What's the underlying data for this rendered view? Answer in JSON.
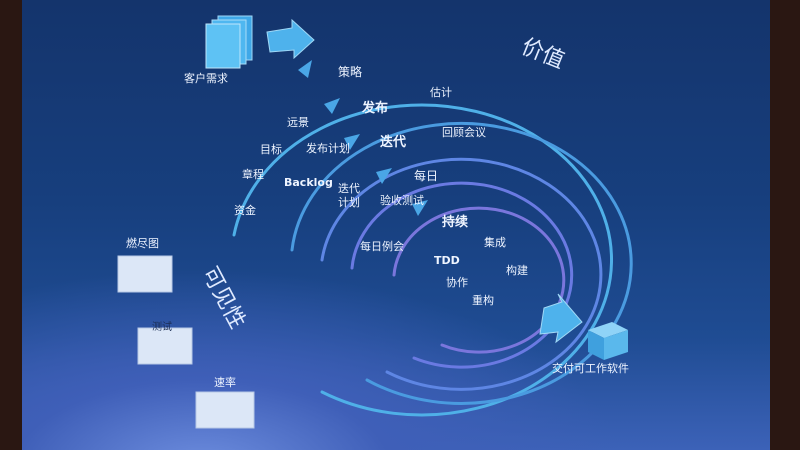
{
  "diagram": {
    "customer_requirements": "客户需求",
    "value": "价值",
    "visibility": "可见性",
    "deliver_working_software": "交付可工作软件",
    "outer_ring": {
      "strategy": "策略",
      "vision": "远景",
      "goals": "目标",
      "charter": "章程",
      "funding": "资金"
    },
    "release_ring": {
      "release": "发布",
      "estimate": "估计",
      "release_plan": "发布计划",
      "backlog": "Backlog"
    },
    "iteration_ring": {
      "iteration": "迭代",
      "retrospective": "回顾会议",
      "iteration_plan": "迭代\n计划"
    },
    "daily_ring": {
      "daily": "每日",
      "acceptance_test": "验收测试",
      "daily_standup": "每日例会"
    },
    "continuous_ring": {
      "continuous": "持续",
      "integration": "集成",
      "tdd": "TDD",
      "build": "构建",
      "collaboration": "协作",
      "refactor": "重构"
    },
    "side_boxes": {
      "burndown": "燃尽图",
      "testing": "测试",
      "velocity": "速率"
    },
    "colors": {
      "ring_outer": "#4fb0e8",
      "ring_inner": "#6a7fe6",
      "arrow": "#4aa6e6"
    }
  }
}
